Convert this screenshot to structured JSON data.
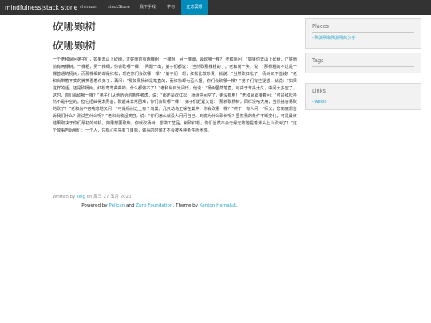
{
  "navbar": {
    "brand": "mindfulness|stack stone",
    "items": [
      {
        "label": "chinazen"
      },
      {
        "label": "stackStone"
      },
      {
        "label": "我下手戏"
      },
      {
        "label": "学习"
      },
      {
        "label": "正念冥想",
        "active": true
      }
    ],
    "colors": {
      "bar": "#333333",
      "active": "#008cba"
    }
  },
  "article": {
    "title": "砍哪颗树",
    "heading": "砍哪颗树",
    "body": "一个老和尚问弟子们，如果去山上砍树，正好面前有两棵树，一棵粗，另一棵细，会砍哪一棵？ 老和尚问：“如果你去山上砍树，正好面前有两棵树，一棵粗，另一棵细，你会砍哪一棵？”问题一出，弟子们都说：“当然砍那棵粗的了。”老和尚一笑，说：“那棵粗的不过是一棵普通的杨树，而那棵细的却是红松，现在你们会砍哪一棵？”弟子们一想，红松比较珍贵，就说：“当然砍红松了，杨树又不值钱！”老和尚带着不变的微笑看着众弟子，再问：“那如果杨树是笔直的，而红松却七歪八扭，你们会砍哪一棵？”弟子们有些疑惑，就说：“如果这样的话，还是砍杨树。红松弯弯曲曲的，什么都做不了！”老和尚目光闪烁，他说：“杨树虽然笔直，可由于年头太久，中间大多空了，这时，你们会砍哪一棵？”弟子们从他所给的条件考虑，说：“那还是砍红松，杨树中间空了，更没有用！”老和尚紧接着问：“可是红松虽然不是中空的，但它扭曲得太厉害，砍起来非常困难，你们会砍哪一棵？”弟子们赶紧又说：“那就砍杨树，同样没啥大用，当然挑容易砍的砍了！”老和尚不容喘息地又问：“可是杨树之上有个鸟巢，几只幼鸟正躲在巢中，你会砍哪一棵？”终于，有人问：“师父，您到底想告诉我们什么？测试些什么呢？”老和尚收起笑容，说：“你们怎么就没人问问自己，到底为什么砍树呢？虽然我的条件不断变化，可是最终结果取决于你们最初的动机。如果想要取柴，你就砍杨树；想做工艺品，就砍红松。你们当然不会无缘无故地提着斧头上山砍树了！”这个故事告诉我们：一个人，只有心中先有了目标，做事的时候才不会被各种条件所迷惑。",
    "meta": {
      "prefix": "Written by",
      "author": "sing",
      "date_prefix": "on",
      "date": "周三 27 五月 2020."
    }
  },
  "footer": {
    "powered": "Powered by",
    "pelican": "Pelican",
    "and": "and",
    "foundation": "Zurb Foundation",
    "theme": ". Theme by",
    "author": "Kenton Hamaluk",
    "end": "."
  },
  "sidebar": {
    "places": {
      "title": "Places",
      "link": "- 陶渊明和陶渊明的分手"
    },
    "tags": {
      "title": "Tags"
    },
    "links": {
      "title": "Links",
      "link": "- weibo"
    }
  },
  "colors": {
    "link": "#2ba6cb",
    "panel_bg": "#f2f2f2"
  }
}
